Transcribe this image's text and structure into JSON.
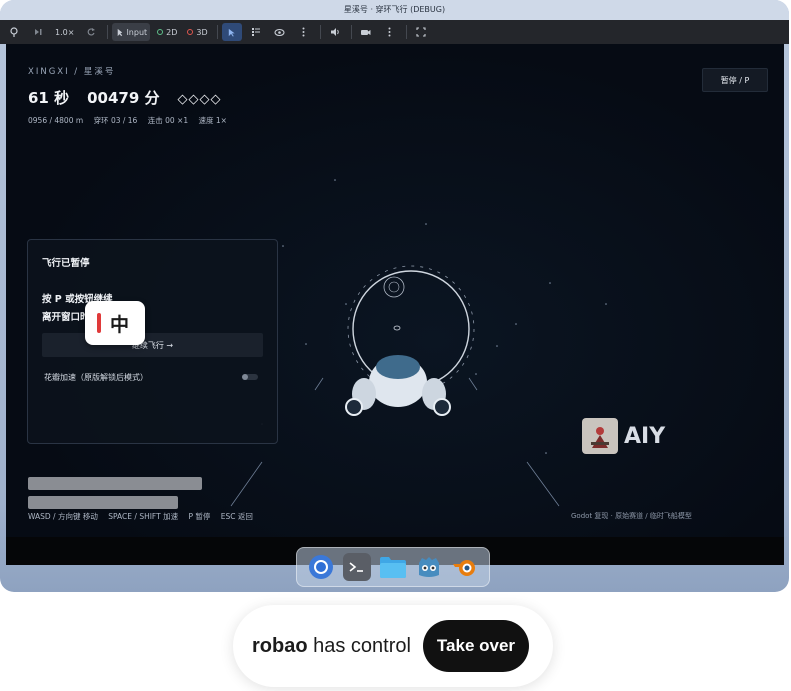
{
  "window": {
    "title": "星溪号 · 穿环飞行 (DEBUG)"
  },
  "toolbar": {
    "speed": "1.0×",
    "input_label": "Input",
    "mode_2d": "2D",
    "mode_3d": "3D"
  },
  "hud": {
    "brand": "XINGXI / 星溪号",
    "time": "61 秒",
    "score": "00479 分",
    "gems": "◇◇◇◇",
    "distance": "0956 / 4800 m",
    "rings": "穿环 03 / 16",
    "combo": "连击 00 ×1",
    "speed": "速度 1×",
    "pause_button": "暂停 / P"
  },
  "pause_panel": {
    "title": "飞行已暂停",
    "line1": "按 P 或按钮继续",
    "line2": "离开窗口时自动暂停",
    "continue_button": "继续飞行 →",
    "toggle_label": "花瓣加速（原版解锁后模式）",
    "toggle_on": false
  },
  "ime": {
    "label": "中",
    "accent": "#e03a3a"
  },
  "controls_hint": {
    "move": "WASD / 方向键 移动",
    "boost": "SPACE / SHIFT 加速",
    "pause": "P 暂停",
    "back": "ESC 返回"
  },
  "credit": "Godot 复现 · 原始赛道 / 临时飞船模型",
  "watermark": {
    "text": "AIY"
  },
  "dock": {
    "apps": [
      {
        "name": "chrome-icon"
      },
      {
        "name": "terminal-icon"
      },
      {
        "name": "files-icon"
      },
      {
        "name": "godot-icon"
      },
      {
        "name": "blender-icon"
      }
    ]
  },
  "control_banner": {
    "user": "robao",
    "message": "has control",
    "button": "Take over"
  },
  "colors": {
    "viewport_bg": "#060b14",
    "accent_select": "#2f4a78"
  }
}
